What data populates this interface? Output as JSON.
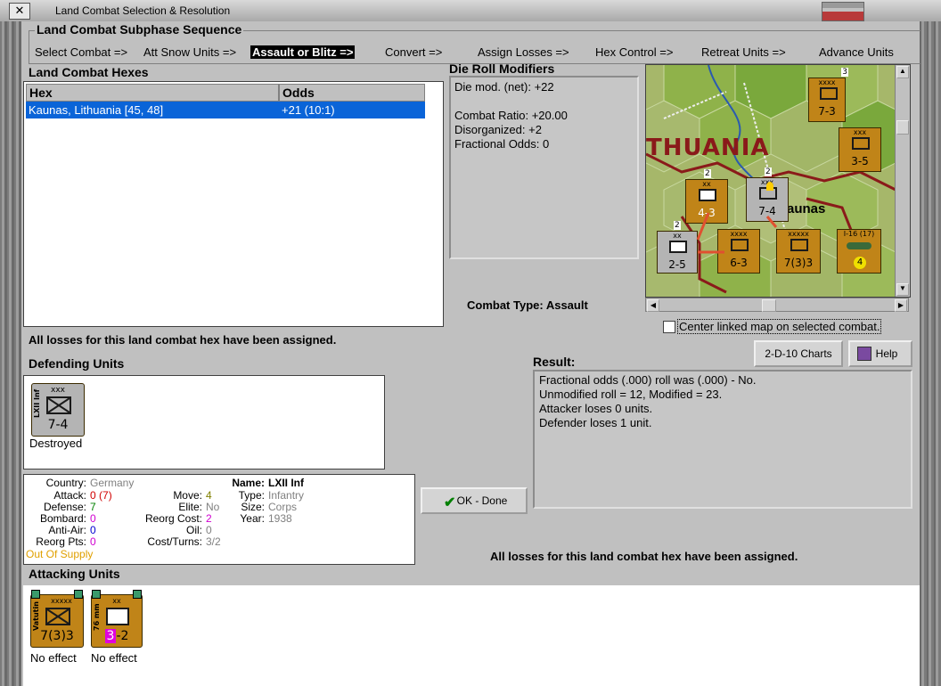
{
  "window": {
    "title": "Land Combat Selection & Resolution",
    "close_label": "✕"
  },
  "sequence": {
    "title": "Land Combat Subphase Sequence",
    "items": [
      "Select Combat =>",
      "Att Snow Units =>",
      "Assault or Blitz =>",
      "Convert =>",
      "Assign Losses =>",
      "Hex Control =>",
      "Retreat Units =>",
      "Advance Units"
    ]
  },
  "hexes": {
    "title": "Land Combat Hexes",
    "columns": [
      "Hex",
      "Odds"
    ],
    "rows": [
      {
        "hex": "Kaunas, Lithuania [45, 48]",
        "odds": "+21 (10:1)"
      }
    ]
  },
  "modifiers": {
    "title": "Die Roll Modifiers",
    "lines": [
      "Die mod. (net): +22",
      "",
      "Combat Ratio: +20.00",
      "Disorganized: +2",
      "Fractional Odds: 0"
    ]
  },
  "combat_type": "Combat Type:  Assault",
  "map": {
    "label": "THUANIA",
    "city": "aunas",
    "counters": [
      {
        "name": "counter-7-3-top",
        "size": "xxxx",
        "strength": "7-3",
        "stack": "3"
      },
      {
        "name": "counter-3-5",
        "size": "xxx",
        "strength": "3-5"
      },
      {
        "name": "counter-4-3",
        "size": "xx",
        "strength": "4-3",
        "stack": "2"
      },
      {
        "name": "counter-7-4-map",
        "size": "xxx",
        "strength": "7-4",
        "stack": "2"
      },
      {
        "name": "counter-2-5",
        "size": "xx",
        "strength": "2-5",
        "stack": "2"
      },
      {
        "name": "counter-6-3",
        "size": "xxxx",
        "strength": "6-3"
      },
      {
        "name": "counter-7-3-3-map",
        "size": "xxxxx",
        "strength": "7(3)3"
      },
      {
        "name": "counter-i16",
        "size": "I-16 (17)",
        "strength": "4"
      }
    ]
  },
  "center_map_label": "Center linked map on selected combat.",
  "losses_msg": "All losses for this land combat hex have been assigned.",
  "buttons": {
    "charts": "2-D-10 Charts",
    "help": "Help",
    "ok": "OK - Done"
  },
  "result": {
    "title": "Result:",
    "lines": [
      "Fractional odds (.000) roll was (.000)  - No.",
      "Unmodified roll = 12, Modified = 23.",
      "Attacker loses 0 units.",
      "Defender loses 1 unit."
    ]
  },
  "defending": {
    "title": "Defending Units",
    "units": [
      {
        "size": "xxx",
        "side": "LXII Inf",
        "strength": "7-4",
        "status": "Destroyed"
      }
    ]
  },
  "unit_info": {
    "country_label": "Country:",
    "country": "Germany",
    "attack_label": "Attack:",
    "attack": "0",
    "attack_paren": "(7)",
    "defense_label": "Defense:",
    "defense": "7",
    "bombard_label": "Bombard:",
    "bombard": "0",
    "antiair_label": "Anti-Air:",
    "antiair": "0",
    "reorg_pts_label": "Reorg Pts:",
    "reorg_pts": "0",
    "supply": "Out Of Supply",
    "move_label": "Move:",
    "move": "4",
    "elite_label": "Elite:",
    "elite": "No",
    "reorg_cost_label": "Reorg Cost:",
    "reorg_cost": "2",
    "oil_label": "Oil:",
    "oil": "0",
    "cost_turns_label": "Cost/Turns:",
    "cost_turns": "3/2",
    "name_label": "Name:",
    "name": "LXII Inf",
    "type_label": "Type:",
    "type": "Infantry",
    "size_label": "Size:",
    "size": "Corps",
    "year_label": "Year:",
    "year": "1938"
  },
  "attacking": {
    "title": "Attacking Units",
    "units": [
      {
        "size": "xxxxx",
        "side": "Vatutin",
        "strength": "7(3)3",
        "status": "No effect"
      },
      {
        "size": "xx",
        "side": "76 mm",
        "strength_a": "3",
        "strength_b": "-2",
        "status": "No effect"
      }
    ]
  },
  "colors": {
    "selection": "#0a64d8",
    "unit_orange": "#c08418",
    "unit_gray": "#b4b4b4",
    "supply": "#e0a000",
    "red": "#d00000",
    "green": "#008000",
    "magenta": "#d000d0",
    "blue": "#0000d0",
    "muted": "#808080"
  }
}
